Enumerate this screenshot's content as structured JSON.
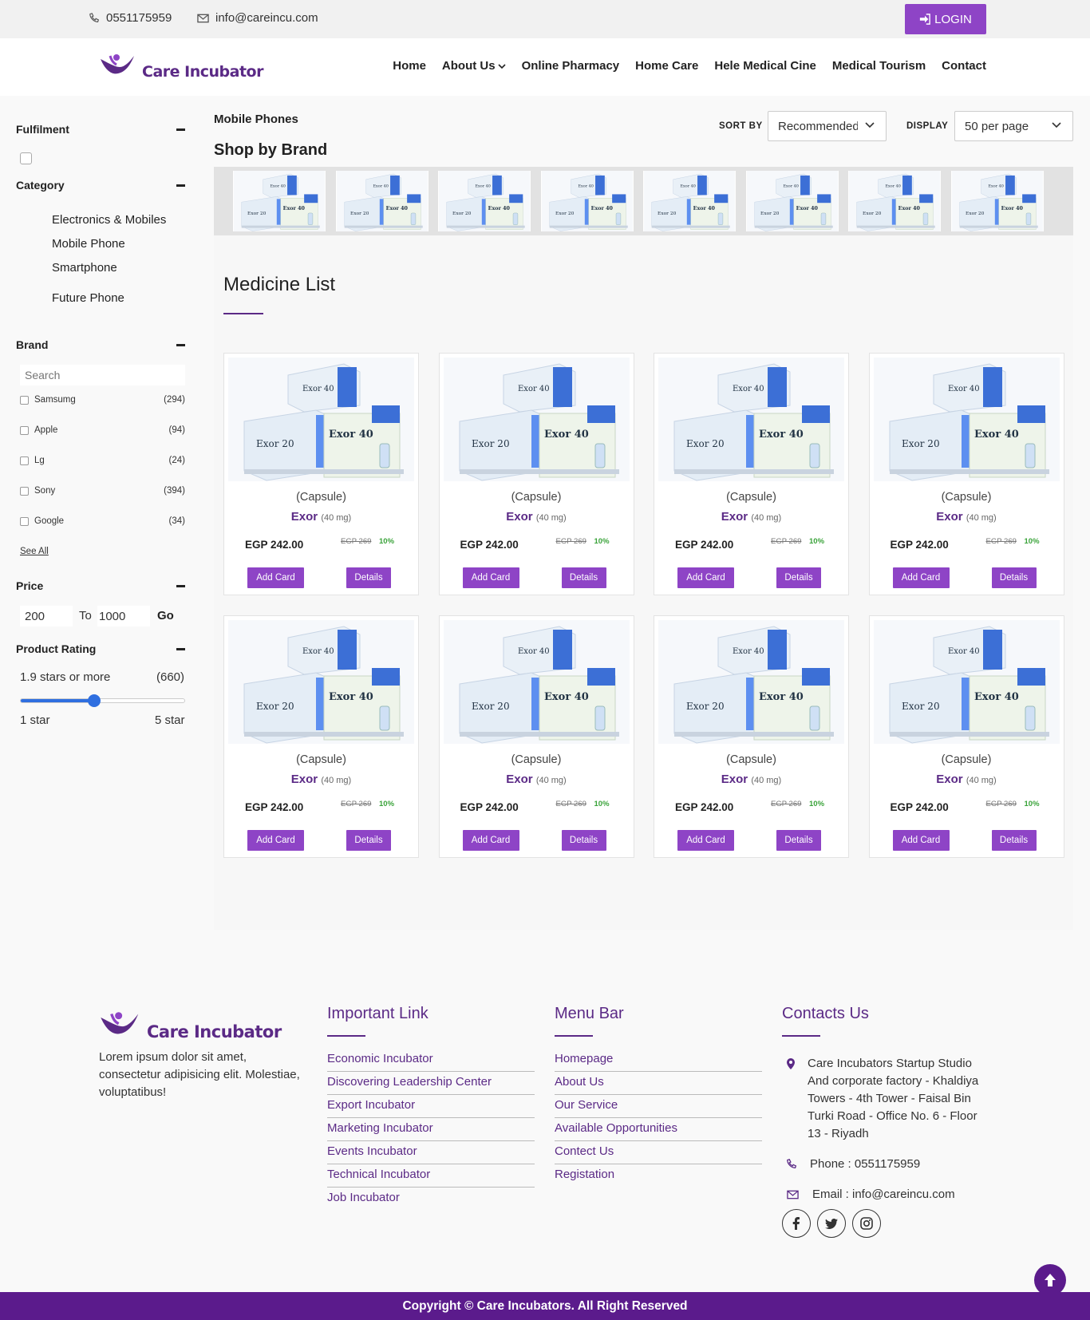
{
  "topbar": {
    "phone": "0551175959",
    "email": "info@careincu.com",
    "login_label": "LOGIN"
  },
  "header": {
    "logo_text": "Care Incubator",
    "nav": [
      "Home",
      "About Us",
      "Online Pharmacy",
      "Home Care",
      "Hele Medical Cine",
      "Medical Tourism",
      "Contact"
    ]
  },
  "sidebar": {
    "fulfilment_title": "Fulfilment",
    "category_title": "Category",
    "categories": [
      "Electronics & Mobiles",
      "Mobile Phone",
      "Smartphone",
      "Future Phone"
    ],
    "brand_title": "Brand",
    "brand_search_placeholder": "Search",
    "brands": [
      {
        "name": "Samsumg",
        "count": "(294)"
      },
      {
        "name": "Apple",
        "count": "(94)"
      },
      {
        "name": "Lg",
        "count": "(24)"
      },
      {
        "name": "Sony",
        "count": "(394)"
      },
      {
        "name": "Google",
        "count": "(34)"
      }
    ],
    "see_all": "See All",
    "price_title": "Price",
    "price_min": "200",
    "price_to": "To",
    "price_max": "1000",
    "price_go": "Go",
    "rating_title": "Product Rating",
    "rating_text": "1.9 stars or more",
    "rating_count": "(660)",
    "rating_value": 0.45,
    "rating_min_label": "1 star",
    "rating_max_label": "5 star"
  },
  "main": {
    "breadcrumb": "Mobile Phones",
    "sort_label": "SORT BY",
    "sort_value": "Recommended",
    "display_label": "DISPLAY",
    "display_value": "50 per page",
    "shop_by_brand": "Shop by Brand",
    "list_title": "Medicine List"
  },
  "products": [
    {
      "form": "(Capsule)",
      "name": "Exor",
      "dose": "(40 mg)",
      "price": "EGP 242.00",
      "old_price": "EGP 269",
      "discount": "10%",
      "add_label": "Add Card",
      "details_label": "Details"
    },
    {
      "form": "(Capsule)",
      "name": "Exor",
      "dose": "(40 mg)",
      "price": "EGP 242.00",
      "old_price": "EGP 269",
      "discount": "10%",
      "add_label": "Add Card",
      "details_label": "Details"
    },
    {
      "form": "(Capsule)",
      "name": "Exor",
      "dose": "(40 mg)",
      "price": "EGP 242.00",
      "old_price": "EGP 269",
      "discount": "10%",
      "add_label": "Add Card",
      "details_label": "Details"
    },
    {
      "form": "(Capsule)",
      "name": "Exor",
      "dose": "(40 mg)",
      "price": "EGP 242.00",
      "old_price": "EGP 269",
      "discount": "10%",
      "add_label": "Add Card",
      "details_label": "Details"
    },
    {
      "form": "(Capsule)",
      "name": "Exor",
      "dose": "(40 mg)",
      "price": "EGP 242.00",
      "old_price": "EGP 269",
      "discount": "10%",
      "add_label": "Add Card",
      "details_label": "Details"
    },
    {
      "form": "(Capsule)",
      "name": "Exor",
      "dose": "(40 mg)",
      "price": "EGP 242.00",
      "old_price": "EGP 269",
      "discount": "10%",
      "add_label": "Add Card",
      "details_label": "Details"
    },
    {
      "form": "(Capsule)",
      "name": "Exor",
      "dose": "(40 mg)",
      "price": "EGP 242.00",
      "old_price": "EGP 269",
      "discount": "10%",
      "add_label": "Add Card",
      "details_label": "Details"
    },
    {
      "form": "(Capsule)",
      "name": "Exor",
      "dose": "(40 mg)",
      "price": "EGP 242.00",
      "old_price": "EGP 269",
      "discount": "10%",
      "add_label": "Add Card",
      "details_label": "Details"
    }
  ],
  "product_image": {
    "box_a": "Exor 40",
    "box_b": "Exor 20",
    "box_c": "Exor 40"
  },
  "footer": {
    "logo_text": "Care Incubator",
    "about": "Lorem ipsum dolor sit amet, consectetur adipisicing elit. Molestiae, voluptatibus!",
    "important_title": "Important Link",
    "important_links": [
      "Economic Incubator",
      "Discovering Leadership Center",
      "Export Incubator",
      "Marketing Incubator",
      "Events Incubator",
      "Technical Incubator",
      "Job Incubator"
    ],
    "menu_title": "Menu Bar",
    "menu_links": [
      "Homepage",
      "About Us",
      "Our Service",
      "Available Opportunities",
      "Contect Us",
      "Registation"
    ],
    "contact_title": "Contacts Us",
    "address": "Care Incubators Startup Studio And corporate factory - Khaldiya Towers - 4th Tower - Faisal Bin Turki Road - Office No. 6 - Floor 13 - Riyadh",
    "phone": "Phone : 0551175959",
    "email": "Email : info@careincu.com",
    "copyright": "Copyright © Care Incubators. All Right Reserved"
  },
  "colors": {
    "brand": "#5b2a86",
    "accent": "#8e44c6",
    "footer_bar": "#5b1b8c",
    "discount": "#3aa33a"
  }
}
